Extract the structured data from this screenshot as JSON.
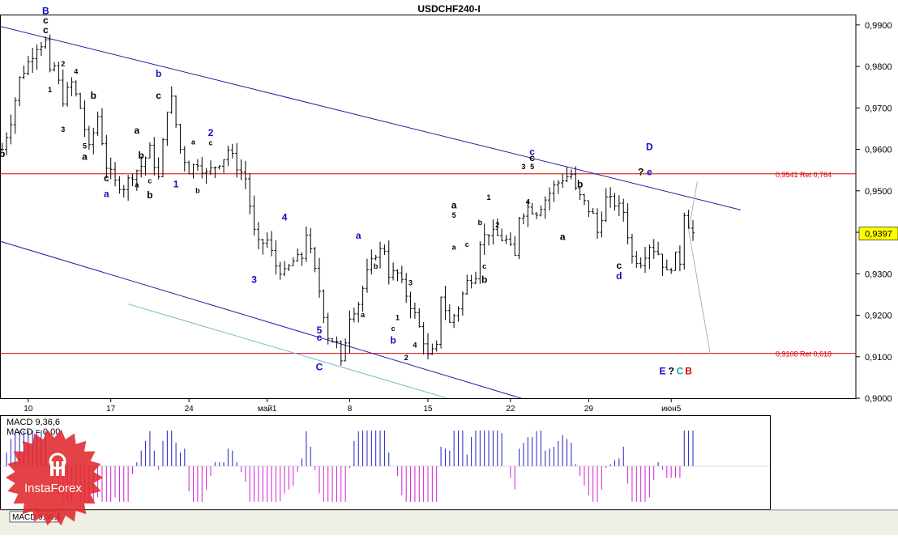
{
  "chart_data": {
    "type": "candlestick",
    "title": "USDCHF240-I",
    "y_axis": {
      "range": [
        0.9,
        0.9925
      ],
      "ticks": [
        "0,9000",
        "0,9100",
        "0,9200",
        "0,9300",
        "0,9400",
        "0,9500",
        "0,9600",
        "0,9700",
        "0,9800",
        "0,9900"
      ],
      "tick_values": [
        0.9,
        0.91,
        0.92,
        0.93,
        0.94,
        0.95,
        0.96,
        0.97,
        0.98,
        0.99
      ]
    },
    "x_axis": {
      "bars_visible": 197,
      "ticks": [
        {
          "label": "10",
          "bar": 6
        },
        {
          "label": "17",
          "bar": 25
        },
        {
          "label": "24",
          "bar": 43
        },
        {
          "label": "май1",
          "bar": 61
        },
        {
          "label": "8",
          "bar": 80
        },
        {
          "label": "15",
          "bar": 98
        },
        {
          "label": "22",
          "bar": 117
        },
        {
          "label": "29",
          "bar": 135
        },
        {
          "label": "июн5",
          "bar": 154
        }
      ]
    },
    "current_price": {
      "label": "0,9397",
      "value": 0.9397
    },
    "hlines": [
      {
        "value": 0.9541,
        "label": "0,9541 Ret 0,764",
        "color": "#dd0000"
      },
      {
        "value": 0.9108,
        "label": "0,9108 Ret 0,618",
        "color": "#dd0000"
      }
    ],
    "trendlines": [
      {
        "from": [
          -1,
          0.9898
        ],
        "to": [
          170,
          0.9454
        ],
        "color": "#2020a0"
      },
      {
        "from": [
          -1,
          0.938
        ],
        "to": [
          121,
          0.8995
        ],
        "color": "#2020a0"
      },
      {
        "from": [
          29,
          0.9227
        ],
        "to": [
          104,
          0.8995
        ],
        "color": "#7fb8c8"
      },
      {
        "from": [
          160,
          0.9522
        ],
        "to": [
          158,
          0.9405
        ],
        "color": "#b0b0b0"
      },
      {
        "from": [
          158,
          0.9405
        ],
        "to": [
          163,
          0.9106
        ],
        "color": "#b0b0b0"
      }
    ],
    "anchors": [
      [
        0,
        0.96
      ],
      [
        2,
        0.967
      ],
      [
        4,
        0.977
      ],
      [
        6,
        0.981
      ],
      [
        8,
        0.985
      ],
      [
        10,
        0.986
      ],
      [
        11,
        0.978
      ],
      [
        12,
        0.98
      ],
      [
        14,
        0.972
      ],
      [
        16,
        0.976
      ],
      [
        18,
        0.97
      ],
      [
        20,
        0.96
      ],
      [
        22,
        0.968
      ],
      [
        24,
        0.956
      ],
      [
        26,
        0.952
      ],
      [
        28,
        0.951
      ],
      [
        30,
        0.954
      ],
      [
        32,
        0.956
      ],
      [
        34,
        0.96
      ],
      [
        36,
        0.953
      ],
      [
        38,
        0.97
      ],
      [
        39,
        0.972
      ],
      [
        41,
        0.96
      ],
      [
        43,
        0.955
      ],
      [
        45,
        0.957
      ],
      [
        47,
        0.954
      ],
      [
        49,
        0.956
      ],
      [
        51,
        0.958
      ],
      [
        52,
        0.96
      ],
      [
        54,
        0.956
      ],
      [
        56,
        0.953
      ],
      [
        58,
        0.94
      ],
      [
        59,
        0.937
      ],
      [
        61,
        0.938
      ],
      [
        63,
        0.932
      ],
      [
        65,
        0.93
      ],
      [
        67,
        0.933
      ],
      [
        69,
        0.934
      ],
      [
        70,
        0.94
      ],
      [
        71,
        0.935
      ],
      [
        73,
        0.926
      ],
      [
        75,
        0.915
      ],
      [
        77,
        0.913
      ],
      [
        78,
        0.908
      ],
      [
        80,
        0.92
      ],
      [
        82,
        0.923
      ],
      [
        84,
        0.93
      ],
      [
        86,
        0.935
      ],
      [
        88,
        0.936
      ],
      [
        89,
        0.93
      ],
      [
        91,
        0.93
      ],
      [
        93,
        0.925
      ],
      [
        95,
        0.92
      ],
      [
        97,
        0.914
      ],
      [
        98,
        0.91
      ],
      [
        100,
        0.912
      ],
      [
        101,
        0.925
      ],
      [
        103,
        0.918
      ],
      [
        105,
        0.922
      ],
      [
        107,
        0.928
      ],
      [
        109,
        0.93
      ],
      [
        110,
        0.938
      ],
      [
        112,
        0.94
      ],
      [
        114,
        0.939
      ],
      [
        116,
        0.938
      ],
      [
        118,
        0.934
      ],
      [
        119,
        0.944
      ],
      [
        121,
        0.946
      ],
      [
        123,
        0.945
      ],
      [
        125,
        0.948
      ],
      [
        127,
        0.951
      ],
      [
        129,
        0.953
      ],
      [
        131,
        0.954
      ],
      [
        132,
        0.95
      ],
      [
        134,
        0.947
      ],
      [
        136,
        0.944
      ],
      [
        137,
        0.94
      ],
      [
        139,
        0.948
      ],
      [
        141,
        0.947
      ],
      [
        143,
        0.945
      ],
      [
        145,
        0.934
      ],
      [
        147,
        0.933
      ],
      [
        149,
        0.937
      ],
      [
        151,
        0.935
      ],
      [
        153,
        0.93
      ],
      [
        155,
        0.934
      ],
      [
        156,
        0.933
      ],
      [
        157,
        0.945
      ],
      [
        158,
        0.942
      ],
      [
        159,
        0.9397
      ]
    ],
    "wave_labels": [
      {
        "text": "B",
        "bar": 10,
        "price": 0.9926,
        "color": "#1010c0"
      },
      {
        "text": "c",
        "bar": 10,
        "price": 0.9904,
        "color": "#000000"
      },
      {
        "text": "c",
        "bar": 10,
        "price": 0.988,
        "color": "#000000"
      },
      {
        "text": "2",
        "bar": 14,
        "price": 0.98,
        "color": "#000000",
        "small": true
      },
      {
        "text": "1",
        "bar": 11,
        "price": 0.9738,
        "color": "#000000",
        "small": true
      },
      {
        "text": "4",
        "bar": 17,
        "price": 0.9782,
        "color": "#000000",
        "small": true
      },
      {
        "text": "3",
        "bar": 14,
        "price": 0.9642,
        "color": "#000000",
        "small": true
      },
      {
        "text": "b",
        "bar": 21,
        "price": 0.9722,
        "color": "#000000"
      },
      {
        "text": "5",
        "bar": 19,
        "price": 0.9602,
        "color": "#000000",
        "small": true
      },
      {
        "text": "a",
        "bar": 19,
        "price": 0.9575,
        "color": "#000000"
      },
      {
        "text": "b",
        "bar": 0,
        "price": 0.9582,
        "color": "#000000"
      },
      {
        "text": "c",
        "bar": 24,
        "price": 0.9523,
        "color": "#000000"
      },
      {
        "text": "a",
        "bar": 24,
        "price": 0.9485,
        "color": "#1010c0"
      },
      {
        "text": "a",
        "bar": 31,
        "price": 0.9638,
        "color": "#000000"
      },
      {
        "text": "b",
        "bar": 32,
        "price": 0.9578,
        "color": "#000000"
      },
      {
        "text": "a",
        "bar": 31,
        "price": 0.9508,
        "color": "#000000",
        "small": true
      },
      {
        "text": "c",
        "bar": 34,
        "price": 0.9518,
        "color": "#000000",
        "small": true
      },
      {
        "text": "b",
        "bar": 34,
        "price": 0.9482,
        "color": "#000000"
      },
      {
        "text": "b",
        "bar": 36,
        "price": 0.9775,
        "color": "#1010c0"
      },
      {
        "text": "c",
        "bar": 36,
        "price": 0.9722,
        "color": "#000000"
      },
      {
        "text": "1",
        "bar": 40,
        "price": 0.9508,
        "color": "#1010c0"
      },
      {
        "text": "a",
        "bar": 44,
        "price": 0.9612,
        "color": "#000000",
        "small": true
      },
      {
        "text": "b",
        "bar": 45,
        "price": 0.9495,
        "color": "#000000",
        "small": true
      },
      {
        "text": "2",
        "bar": 48,
        "price": 0.9632,
        "color": "#1010c0"
      },
      {
        "text": "c",
        "bar": 48,
        "price": 0.961,
        "color": "#000000",
        "small": true
      },
      {
        "text": "4",
        "bar": 65,
        "price": 0.9428,
        "color": "#1010c0"
      },
      {
        "text": "3",
        "bar": 58,
        "price": 0.9278,
        "color": "#1010c0"
      },
      {
        "text": "5",
        "bar": 73,
        "price": 0.9156,
        "color": "#1010c0"
      },
      {
        "text": "c",
        "bar": 73,
        "price": 0.9139,
        "color": "#1010c0"
      },
      {
        "text": "C",
        "bar": 73,
        "price": 0.9067,
        "color": "#1010c0"
      },
      {
        "text": "a",
        "bar": 82,
        "price": 0.9384,
        "color": "#1010c0"
      },
      {
        "text": "b",
        "bar": 86,
        "price": 0.9312,
        "color": "#000000",
        "small": true
      },
      {
        "text": "a",
        "bar": 83,
        "price": 0.9195,
        "color": "#000000",
        "small": true
      },
      {
        "text": "1",
        "bar": 91,
        "price": 0.9188,
        "color": "#000000",
        "small": true
      },
      {
        "text": "c",
        "bar": 90,
        "price": 0.9162,
        "color": "#000000",
        "small": true
      },
      {
        "text": "b",
        "bar": 90,
        "price": 0.9132,
        "color": "#1010c0"
      },
      {
        "text": "2",
        "bar": 93,
        "price": 0.9092,
        "color": "#000000",
        "small": true
      },
      {
        "text": "3",
        "bar": 94,
        "price": 0.9272,
        "color": "#000000",
        "small": true
      },
      {
        "text": "4",
        "bar": 95,
        "price": 0.9122,
        "color": "#000000",
        "small": true
      },
      {
        "text": "a",
        "bar": 104,
        "price": 0.9458,
        "color": "#000000"
      },
      {
        "text": "5",
        "bar": 104,
        "price": 0.9435,
        "color": "#000000",
        "small": true
      },
      {
        "text": "b",
        "bar": 110,
        "price": 0.9418,
        "color": "#000000",
        "small": true
      },
      {
        "text": "a",
        "bar": 104,
        "price": 0.9358,
        "color": "#000000",
        "small": true
      },
      {
        "text": "c",
        "bar": 107,
        "price": 0.9365,
        "color": "#000000",
        "small": true
      },
      {
        "text": "1",
        "bar": 112,
        "price": 0.9478,
        "color": "#000000",
        "small": true
      },
      {
        "text": "2",
        "bar": 114,
        "price": 0.9412,
        "color": "#000000",
        "small": true
      },
      {
        "text": "c",
        "bar": 111,
        "price": 0.9312,
        "color": "#000000",
        "small": true
      },
      {
        "text": "b",
        "bar": 111,
        "price": 0.9278,
        "color": "#000000"
      },
      {
        "text": "3",
        "bar": 120,
        "price": 0.9552,
        "color": "#000000",
        "small": true
      },
      {
        "text": "c",
        "bar": 122,
        "price": 0.9586,
        "color": "#1010c0"
      },
      {
        "text": "c",
        "bar": 122,
        "price": 0.9572,
        "color": "#000000"
      },
      {
        "text": "5",
        "bar": 122,
        "price": 0.9552,
        "color": "#000000",
        "small": true
      },
      {
        "text": "4",
        "bar": 121,
        "price": 0.9467,
        "color": "#000000",
        "small": true
      },
      {
        "text": "b",
        "bar": 133,
        "price": 0.9508,
        "color": "#000000"
      },
      {
        "text": "a",
        "bar": 129,
        "price": 0.9382,
        "color": "#000000"
      },
      {
        "text": "c",
        "bar": 142,
        "price": 0.9312,
        "color": "#000000"
      },
      {
        "text": "d",
        "bar": 142,
        "price": 0.9287,
        "color": "#1010c0"
      },
      {
        "text": "D",
        "bar": 149,
        "price": 0.9598,
        "color": "#1010c0"
      },
      {
        "text": "?",
        "bar": 147,
        "price": 0.9538,
        "color": "#000000"
      },
      {
        "text": "e",
        "bar": 149,
        "price": 0.9538,
        "color": "#1010c0"
      },
      {
        "text": "E",
        "bar": 152,
        "price": 0.9058,
        "color": "#1010c0"
      },
      {
        "text": "?",
        "bar": 154,
        "price": 0.9058,
        "color": "#000000"
      },
      {
        "text": "C",
        "bar": 156,
        "price": 0.9058,
        "color": "#20a0c0"
      },
      {
        "text": "B",
        "bar": 158,
        "price": 0.9058,
        "color": "#dd0000"
      }
    ],
    "macd": {
      "label": "MACD 9,36,6",
      "value_label": "MACD = 0,00",
      "footer_label": "MACD 9,36,6",
      "positive_color": "#2020c0",
      "negative_color": "#d020d0"
    },
    "watermark": "InstaForex"
  }
}
